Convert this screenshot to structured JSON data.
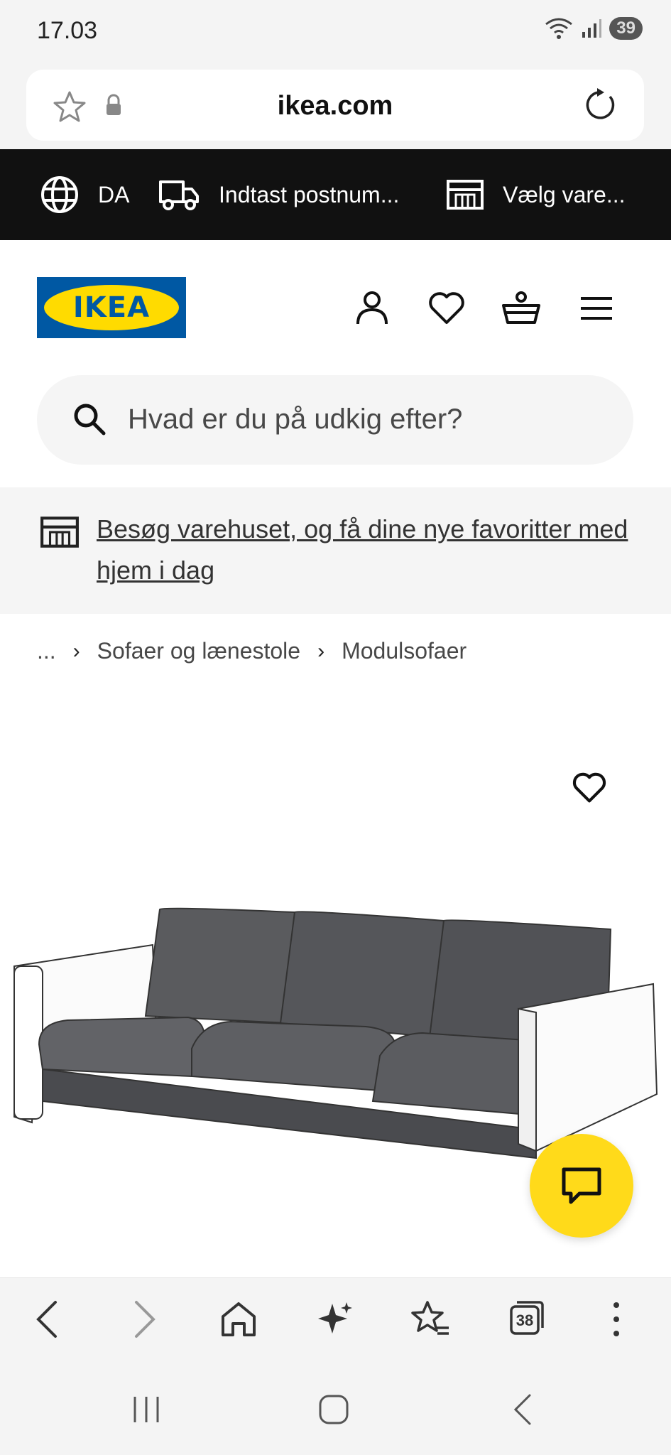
{
  "status_bar": {
    "time": "17.03",
    "battery": "39"
  },
  "browser": {
    "url": "ikea.com",
    "tab_count": "38"
  },
  "top_strip": {
    "language": "DA",
    "postcode_label": "Indtast postnum...",
    "store_label": "Vælg vare..."
  },
  "header": {
    "logo_text": "IKEA"
  },
  "search": {
    "placeholder": "Hvad er du på udkig efter?"
  },
  "promo": {
    "text": "Besøg varehuset, og få dine nye favoritter med hjem i dag"
  },
  "breadcrumb": {
    "ellipsis": "...",
    "items": [
      "Sofaer og lænestole",
      "Modulsofaer"
    ]
  },
  "colors": {
    "brand_blue": "#0058a3",
    "brand_yellow": "#ffdb00",
    "chat_yellow": "#ffda1a",
    "strip_bg": "#111111"
  }
}
